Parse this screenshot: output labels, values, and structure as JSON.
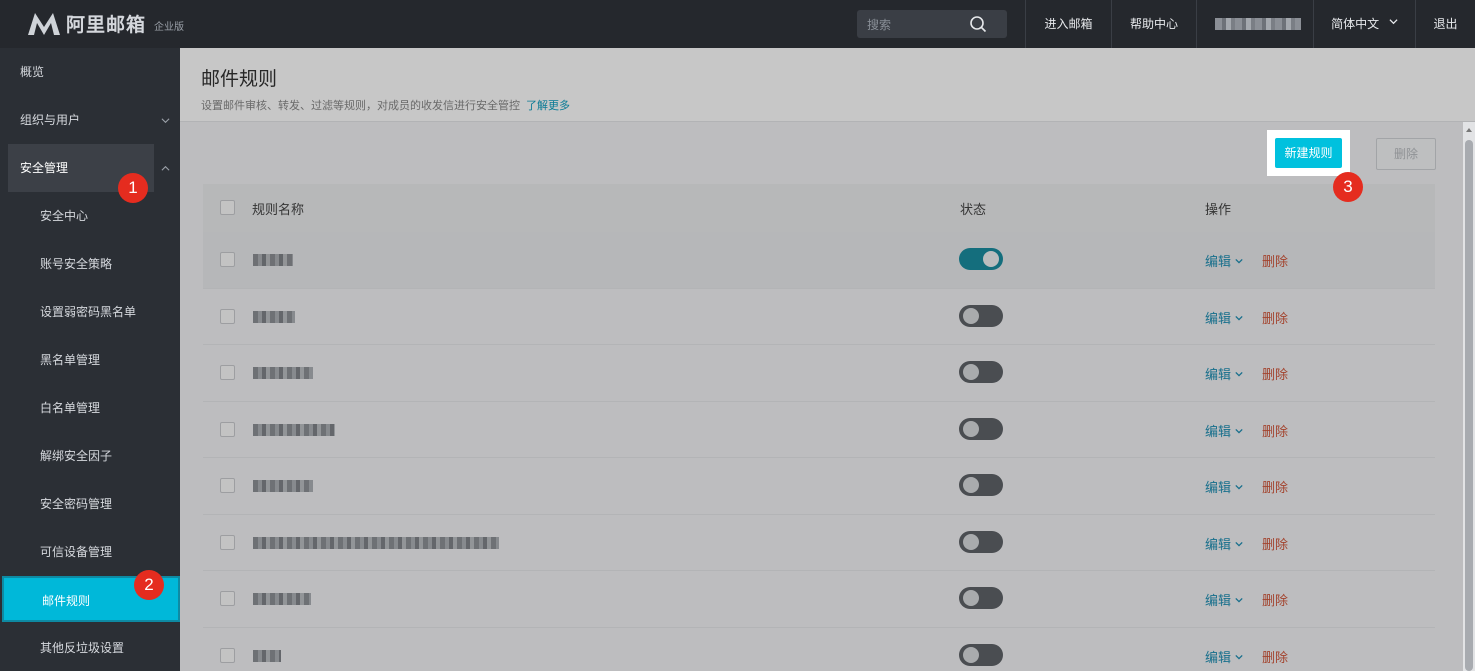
{
  "brand": {
    "name": "阿里邮箱",
    "edition": "企业版"
  },
  "topbar": {
    "search_placeholder": "搜索",
    "enter_mail": "进入邮箱",
    "help": "帮助中心",
    "language": "简体中文",
    "logout": "退出"
  },
  "sidebar": {
    "items": [
      {
        "label": "概览"
      },
      {
        "label": "组织与用户"
      },
      {
        "label": "安全管理"
      },
      {
        "label": "安全中心"
      },
      {
        "label": "账号安全策略"
      },
      {
        "label": "设置弱密码黑名单"
      },
      {
        "label": "黑名单管理"
      },
      {
        "label": "白名单管理"
      },
      {
        "label": "解绑安全因子"
      },
      {
        "label": "安全密码管理"
      },
      {
        "label": "可信设备管理"
      },
      {
        "label": "邮件规则"
      },
      {
        "label": "其他反垃圾设置"
      }
    ]
  },
  "page": {
    "title": "邮件规则",
    "subtitle": "设置邮件审核、转发、过滤等规则，对成员的收发信进行安全管控",
    "learn_more": "了解更多",
    "new_rule": "新建规则",
    "delete": "删除"
  },
  "table": {
    "headers": {
      "name": "规则名称",
      "status": "状态",
      "actions": "操作"
    },
    "edit_label": "编辑",
    "delete_label": "删除",
    "rows": [
      {
        "enabled": true
      },
      {
        "enabled": false
      },
      {
        "enabled": false
      },
      {
        "enabled": false
      },
      {
        "enabled": false
      },
      {
        "enabled": false
      },
      {
        "enabled": false
      },
      {
        "enabled": false
      }
    ]
  },
  "badges": {
    "one": "1",
    "two": "2",
    "three": "3"
  },
  "colors": {
    "accent": "#00c1de",
    "danger": "#d1563a",
    "link": "#1f8fb4",
    "badge": "#e52c1f"
  }
}
